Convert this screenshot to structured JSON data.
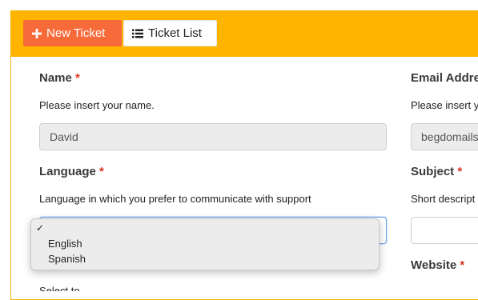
{
  "toolbar": {
    "new_ticket_label": "New Ticket",
    "ticket_list_label": "Ticket List",
    "background": "#ffb400",
    "new_ticket_color": "#f76a3a"
  },
  "form": {
    "name": {
      "label": "Name",
      "required_mark": "*",
      "help": "Please insert your name.",
      "value": "David"
    },
    "email": {
      "label": "Email Addre",
      "help": "Please insert y",
      "value": "begdomails"
    },
    "language": {
      "label": "Language",
      "required_mark": "*",
      "help": "Language in which you prefer to communicate with support",
      "options": [
        "English",
        "Spanish"
      ],
      "selected_check": "✓"
    },
    "subject": {
      "label": "Subject",
      "required_mark": "*",
      "help": "Short descript",
      "value": ""
    },
    "website": {
      "label": "Website",
      "required_mark": "*"
    },
    "support_partial_help": "Select to ......... ........ ....."
  }
}
